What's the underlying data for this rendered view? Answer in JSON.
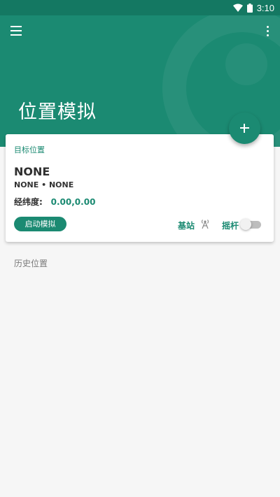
{
  "status_bar": {
    "time": "3:10",
    "icons": [
      "wifi-icon",
      "battery-icon"
    ]
  },
  "app_bar": {
    "menu_icon": "menu-icon",
    "more_icon": "more-vert-icon",
    "title": "位置模拟"
  },
  "fab": {
    "icon": "add-icon"
  },
  "target_card": {
    "label": "目标位置",
    "place_name": "NONE",
    "place_subtitle": "NONE • NONE",
    "coord_label": "经纬度:",
    "coord_value": "0.00,0.00",
    "start_button": "启动模拟",
    "base_station_label": "基站",
    "base_station_icon": "antenna-icon",
    "joystick_label": "摇杆",
    "joystick_enabled": false
  },
  "history": {
    "label": "历史位置"
  },
  "colors": {
    "primary": "#1b8a72",
    "status_bar": "#147862",
    "background": "#f6f6f6"
  }
}
